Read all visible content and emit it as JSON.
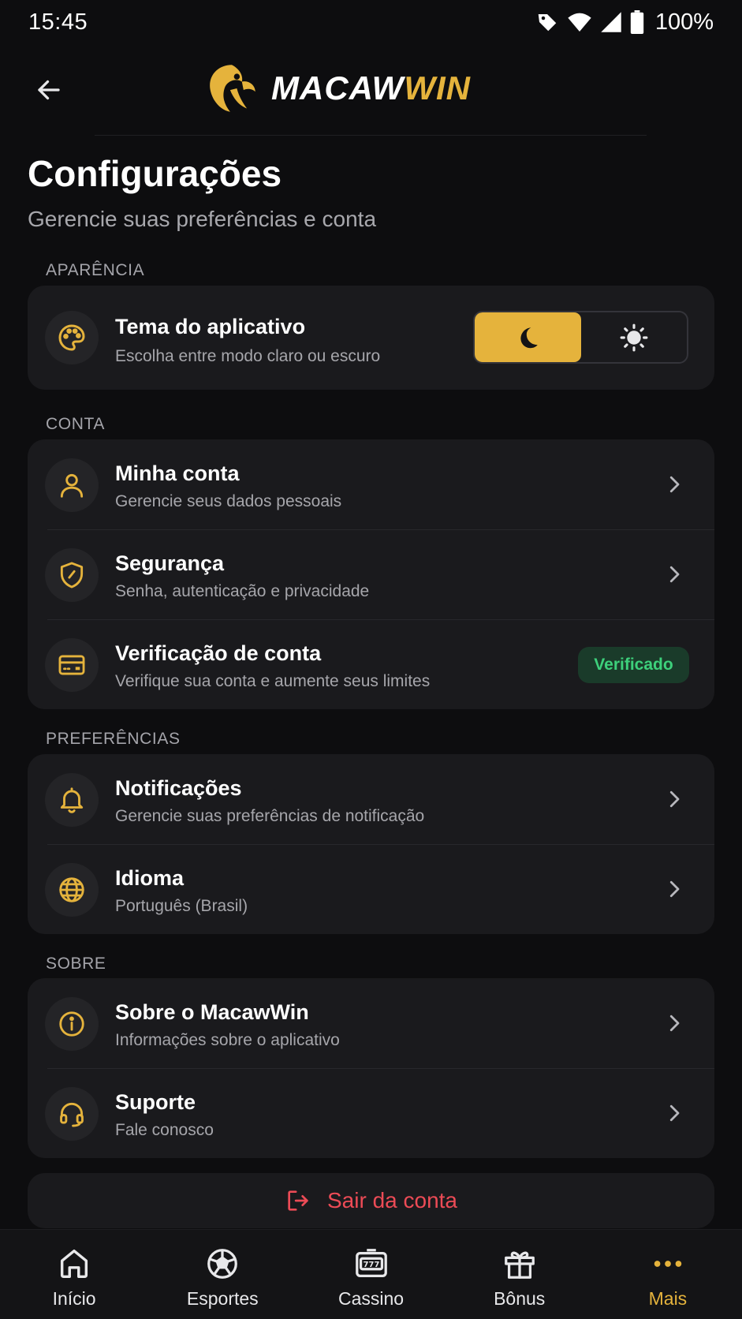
{
  "status_bar": {
    "time": "15:45",
    "battery": "100%"
  },
  "header": {
    "logo_part1": "MACAW",
    "logo_part2": "WIN"
  },
  "page": {
    "title": "Configurações",
    "subtitle": "Gerencie suas preferências e conta"
  },
  "sections": {
    "appearance": {
      "label": "APARÊNCIA",
      "theme": {
        "title": "Tema do aplicativo",
        "subtitle": "Escolha entre modo claro ou escuro",
        "selected": "dark"
      }
    },
    "account": {
      "label": "CONTA",
      "items": [
        {
          "title": "Minha conta",
          "subtitle": "Gerencie seus dados pessoais",
          "icon": "user-icon"
        },
        {
          "title": "Segurança",
          "subtitle": "Senha, autenticação e privacidade",
          "icon": "shield-icon"
        },
        {
          "title": "Verificação de conta",
          "subtitle": "Verifique sua conta e aumente seus limites",
          "icon": "id-card-icon",
          "badge": "Verificado"
        }
      ]
    },
    "preferences": {
      "label": "PREFERÊNCIAS",
      "items": [
        {
          "title": "Notificações",
          "subtitle": "Gerencie suas preferências de notificação",
          "icon": "bell-icon"
        },
        {
          "title": "Idioma",
          "subtitle": "Português (Brasil)",
          "icon": "globe-icon"
        }
      ]
    },
    "about": {
      "label": "SOBRE",
      "items": [
        {
          "title": "Sobre o MacawWin",
          "subtitle": "Informações sobre o aplicativo",
          "icon": "info-icon"
        },
        {
          "title": "Suporte",
          "subtitle": "Fale conosco",
          "icon": "headset-icon"
        }
      ]
    }
  },
  "logout": {
    "label": "Sair da conta"
  },
  "bottom_nav": [
    {
      "label": "Início",
      "icon": "home-icon"
    },
    {
      "label": "Esportes",
      "icon": "soccer-ball-icon"
    },
    {
      "label": "Cassino",
      "icon": "slot-machine-icon"
    },
    {
      "label": "Bônus",
      "icon": "gift-icon"
    },
    {
      "label": "Mais",
      "icon": "more-dots-icon",
      "active": true
    }
  ],
  "colors": {
    "accent": "#e5b33c",
    "background": "#0d0d0f",
    "card": "#1a1a1d",
    "danger": "#ec4b56",
    "success": "#3dd07b"
  }
}
